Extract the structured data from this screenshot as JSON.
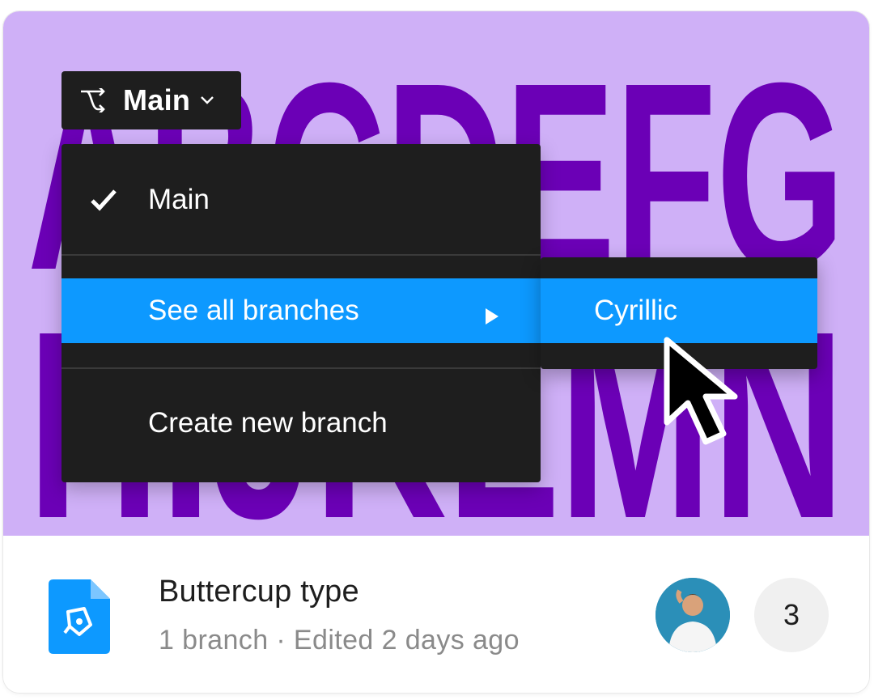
{
  "thumbnail": {
    "background_color": "#cfb0f7",
    "letter_color": "#6b00b6",
    "row1": "ABCDEFG",
    "row2": "HIJKLMN"
  },
  "branch_switcher": {
    "label": "Main",
    "icon": "branch-icon",
    "chevron": "chevron-down-icon"
  },
  "branch_menu": {
    "items": [
      {
        "label": "Main",
        "checked": true
      },
      {
        "label": "See all branches",
        "has_submenu": true,
        "highlighted": true
      },
      {
        "label": "Create new branch"
      }
    ],
    "highlight_color": "#0d99ff"
  },
  "branch_submenu": {
    "items": [
      {
        "label": "Cyrillic",
        "highlighted": true
      }
    ]
  },
  "file": {
    "title": "Buttercup type",
    "meta": "1 branch · Edited 2 days ago",
    "icon": "design-file-icon",
    "icon_color": "#0d99ff",
    "collaborator_count": "3"
  }
}
